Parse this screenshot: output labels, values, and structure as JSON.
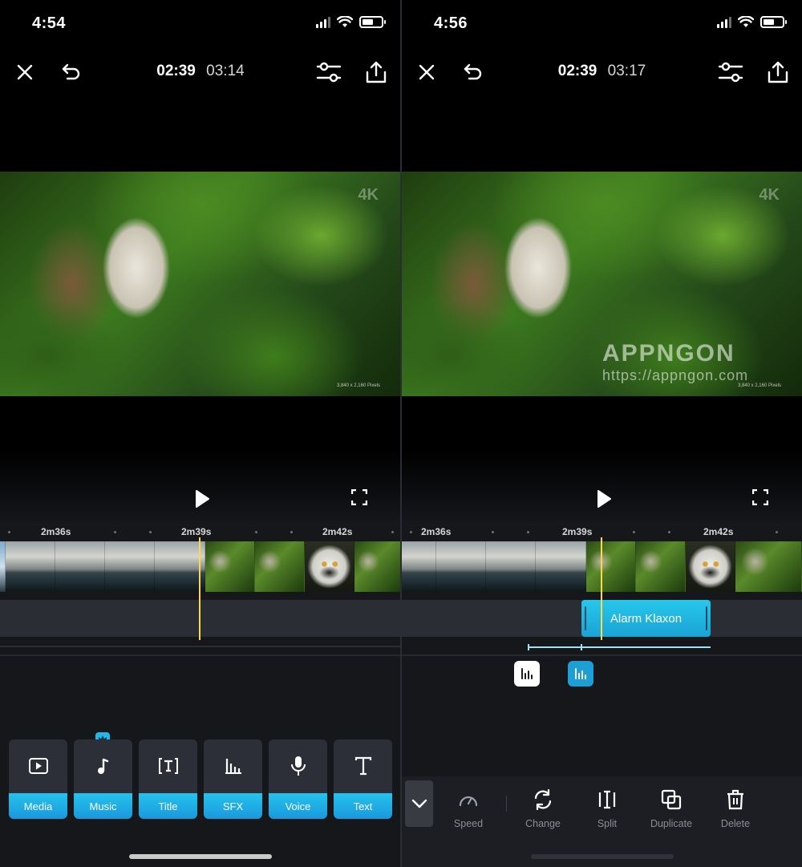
{
  "left": {
    "status_time": "4:54",
    "current_time": "02:39",
    "total_time": "03:14",
    "ruler": [
      "2m36s",
      "2m39s",
      "2m42s"
    ],
    "tools": [
      {
        "label": "Media",
        "icon": "media-icon"
      },
      {
        "label": "Music",
        "icon": "music-icon"
      },
      {
        "label": "Title",
        "icon": "title-icon"
      },
      {
        "label": "SFX",
        "icon": "sfx-icon"
      },
      {
        "label": "Voice",
        "icon": "voice-icon"
      },
      {
        "label": "Text",
        "icon": "text-icon"
      }
    ]
  },
  "right": {
    "status_time": "4:56",
    "current_time": "02:39",
    "total_time": "03:17",
    "ruler": [
      "2m36s",
      "2m39s",
      "2m42s"
    ],
    "audio_clip": "Alarm Klaxon",
    "edit_tools": [
      {
        "label": "Speed",
        "icon": "speed-icon"
      },
      {
        "label": "Change",
        "icon": "change-icon"
      },
      {
        "label": "Split",
        "icon": "split-icon"
      },
      {
        "label": "Duplicate",
        "icon": "duplicate-icon"
      },
      {
        "label": "Delete",
        "icon": "delete-icon"
      }
    ]
  },
  "preview": {
    "badge": "4K",
    "resolution": "3,840 x 2,160 Pixels"
  },
  "watermark": {
    "brand": "APPNGON",
    "url": "https://appngon.com"
  },
  "colors": {
    "accent": "#1fb2e6",
    "playhead": "#ffd84a",
    "panel": "#2c2f37",
    "background": "#15171b"
  }
}
